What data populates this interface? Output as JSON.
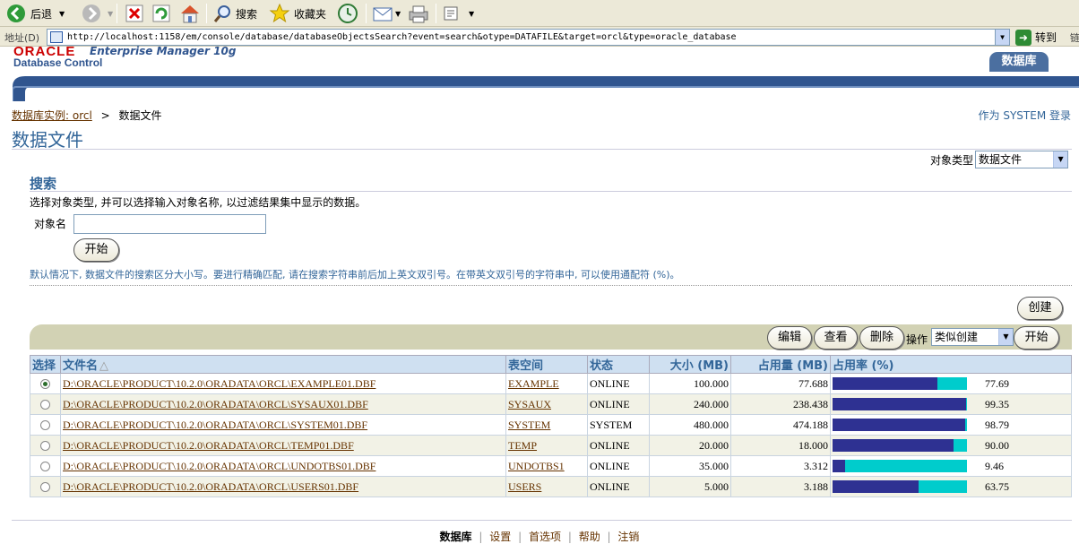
{
  "toolbar": {
    "back": "后退",
    "search": "搜索",
    "favorites": "收藏夹"
  },
  "address": {
    "label": "地址(D)",
    "url": "http://localhost:1158/em/console/database/databaseObjectsSearch?event=search&otype=DATAFILE&target=orcl&type=oracle_database",
    "go": "转到",
    "links": "链"
  },
  "header": {
    "brand": "ORACLE",
    "product": "Enterprise Manager 10g",
    "subtitle": "Database Control",
    "tab": "数据库"
  },
  "breadcrumb": {
    "link": "数据库实例: orcl",
    "sep": ">",
    "current": "数据文件"
  },
  "login": "作为 SYSTEM 登录",
  "page_title": "数据文件",
  "object_type": {
    "label": "对象类型",
    "value": "数据文件"
  },
  "search": {
    "title": "搜索",
    "description": "选择对象类型, 并可以选择输入对象名称, 以过滤结果集中显示的数据。",
    "name_label": "对象名",
    "name_value": "",
    "go": "开始",
    "hint": "默认情况下, 数据文件的搜索区分大小写。要进行精确匹配, 请在搜索字符串前后加上英文双引号。在带英文双引号的字符串中, 可以使用通配符 (%)。"
  },
  "create": "创建",
  "actions": {
    "edit": "编辑",
    "view": "查看",
    "delete": "删除",
    "label": "操作",
    "select": "类似创建",
    "go": "开始"
  },
  "table": {
    "headers": {
      "select": "选择",
      "file": "文件名",
      "tablespace": "表空间",
      "status": "状态",
      "size": "大小 (MB)",
      "used": "占用量 (MB)",
      "pct": "占用率 (%)"
    },
    "rows": [
      {
        "selected": true,
        "file": "D:\\ORACLE\\PRODUCT\\10.2.0\\ORADATA\\ORCL\\EXAMPLE01.DBF",
        "tablespace": "EXAMPLE",
        "status": "ONLINE",
        "size": "100.000",
        "used": "77.688",
        "pct": "77.69"
      },
      {
        "selected": false,
        "file": "D:\\ORACLE\\PRODUCT\\10.2.0\\ORADATA\\ORCL\\SYSAUX01.DBF",
        "tablespace": "SYSAUX",
        "status": "ONLINE",
        "size": "240.000",
        "used": "238.438",
        "pct": "99.35"
      },
      {
        "selected": false,
        "file": "D:\\ORACLE\\PRODUCT\\10.2.0\\ORADATA\\ORCL\\SYSTEM01.DBF",
        "tablespace": "SYSTEM",
        "status": "SYSTEM",
        "size": "480.000",
        "used": "474.188",
        "pct": "98.79"
      },
      {
        "selected": false,
        "file": "D:\\ORACLE\\PRODUCT\\10.2.0\\ORADATA\\ORCL\\TEMP01.DBF",
        "tablespace": "TEMP",
        "status": "ONLINE",
        "size": "20.000",
        "used": "18.000",
        "pct": "90.00"
      },
      {
        "selected": false,
        "file": "D:\\ORACLE\\PRODUCT\\10.2.0\\ORADATA\\ORCL\\UNDOTBS01.DBF",
        "tablespace": "UNDOTBS1",
        "status": "ONLINE",
        "size": "35.000",
        "used": "3.312",
        "pct": "9.46"
      },
      {
        "selected": false,
        "file": "D:\\ORACLE\\PRODUCT\\10.2.0\\ORADATA\\ORCL\\USERS01.DBF",
        "tablespace": "USERS",
        "status": "ONLINE",
        "size": "5.000",
        "used": "3.188",
        "pct": "63.75"
      }
    ]
  },
  "footer": {
    "database": "数据库",
    "setup": "设置",
    "prefs": "首选项",
    "help": "帮助",
    "logout": "注销",
    "sep": "|"
  },
  "colors": {
    "bar_fill": "#2e3192",
    "bar_track": "#00cccc",
    "header_blue": "#336699",
    "link_brown": "#663300",
    "oracle_red": "#cc0000"
  }
}
